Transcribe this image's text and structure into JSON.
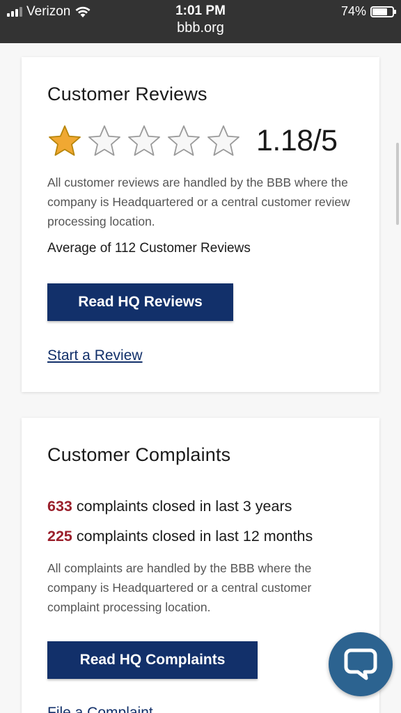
{
  "status_bar": {
    "carrier": "Verizon",
    "time": "1:01 PM",
    "url": "bbb.org",
    "battery_percent": "74%",
    "battery_level": 0.74
  },
  "reviews": {
    "title": "Customer Reviews",
    "rating": "1.18/5",
    "rating_value": 1.18,
    "stars_filled": 1,
    "stars_total": 5,
    "star_color": "#f0a832",
    "description": "All customer reviews are handled by the BBB where the company is Headquartered or a central customer review processing location.",
    "average": "Average of 112 Customer Reviews",
    "button_label": "Read HQ Reviews",
    "link_label": "Start a Review"
  },
  "complaints": {
    "title": "Customer Complaints",
    "stats": [
      {
        "number": "633",
        "text": "complaints closed in last 3 years"
      },
      {
        "number": "225",
        "text": "complaints closed in last 12 months"
      }
    ],
    "description": "All complaints are handled by the BBB where the company is Headquartered or a central customer complaint processing location.",
    "button_label": "Read HQ Complaints",
    "link_label": "File a Complaint"
  },
  "colors": {
    "primary": "#12306a",
    "accent_number": "#9a1f2b",
    "chat_button": "#2c6390"
  },
  "icons": {
    "chat": "chat-bubble-icon",
    "wifi": "wifi-icon",
    "signal": "signal-icon",
    "battery": "battery-icon"
  }
}
